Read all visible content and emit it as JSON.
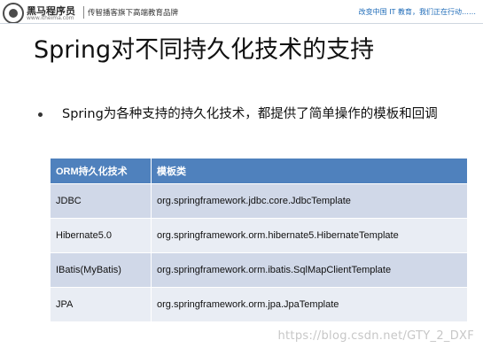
{
  "header": {
    "brand": "黑马程序员",
    "brand_sub": "www.itheima.com",
    "tagline": "传智播客旗下高端教育品牌",
    "slogan": "改变中国 IT 教育，我们正在行动……"
  },
  "slide": {
    "title": "Spring对不同持久化技术的支持",
    "bullet": "Spring为各种支持的持久化技术，都提供了简单操作的模板和回调"
  },
  "table": {
    "headers": [
      "ORM持久化技术",
      "模板类"
    ],
    "rows": [
      [
        "JDBC",
        "org.springframework.jdbc.core.JdbcTemplate"
      ],
      [
        "Hibernate5.0",
        "org.springframework.orm.hibernate5.HibernateTemplate"
      ],
      [
        "IBatis(MyBatis)",
        "org.springframework.orm.ibatis.SqlMapClientTemplate"
      ],
      [
        "JPA",
        "org.springframework.orm.jpa.JpaTemplate"
      ]
    ]
  },
  "watermark": "https://blog.csdn.net/GTY_2_DXF"
}
